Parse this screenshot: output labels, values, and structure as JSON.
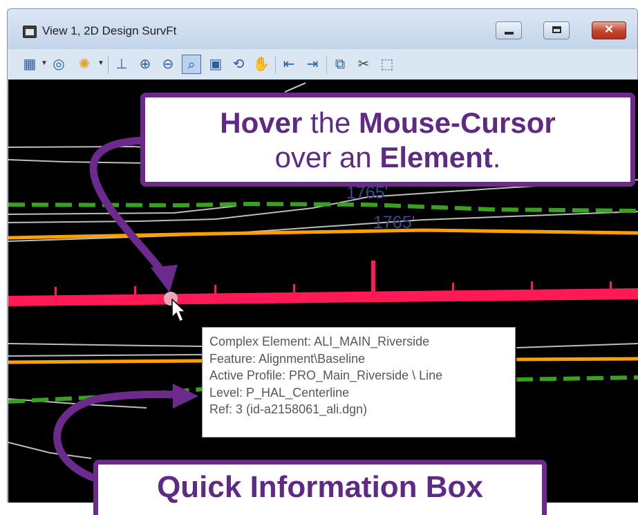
{
  "window": {
    "title": "View 1, 2D Design SurvFt",
    "minimize_symbol": "",
    "maximize_symbol": "",
    "close_symbol": "✕"
  },
  "toolbar": {
    "icons": [
      "view-attributes-icon",
      "display-style-icon",
      "lighting-icon",
      "update-view-icon",
      "zoom-in-icon",
      "zoom-out-icon",
      "window-area-icon",
      "fit-view-icon",
      "rotate-view-icon",
      "pan-view-icon",
      "previous-view-icon",
      "next-view-icon",
      "copy-view-icon",
      "clip-volume-icon",
      "clip-mask-icon"
    ]
  },
  "canvas": {
    "contour_labels": [
      "1765'",
      "1765'"
    ]
  },
  "callouts": {
    "top_parts": [
      "Hover",
      " the ",
      "Mouse-Cursor",
      "over an ",
      "Element",
      "."
    ],
    "bottom": "Quick Information Box"
  },
  "quick_info": {
    "lines": [
      "Complex Element: ALI_MAIN_Riverside",
      "Feature: Alignment\\Baseline",
      "Active Profile: PRO_Main_Riverside \\ Line",
      "Level: P_HAL_Centerline",
      "Ref: 3 (id-a2158061_ali.dgn)"
    ]
  },
  "colors": {
    "callout_purple": "#6b2a8c",
    "alignment_red": "#ff1a55",
    "edge_orange": "#ffa000",
    "dashed_green": "#3aa020",
    "canvas_bg": "#000000"
  }
}
